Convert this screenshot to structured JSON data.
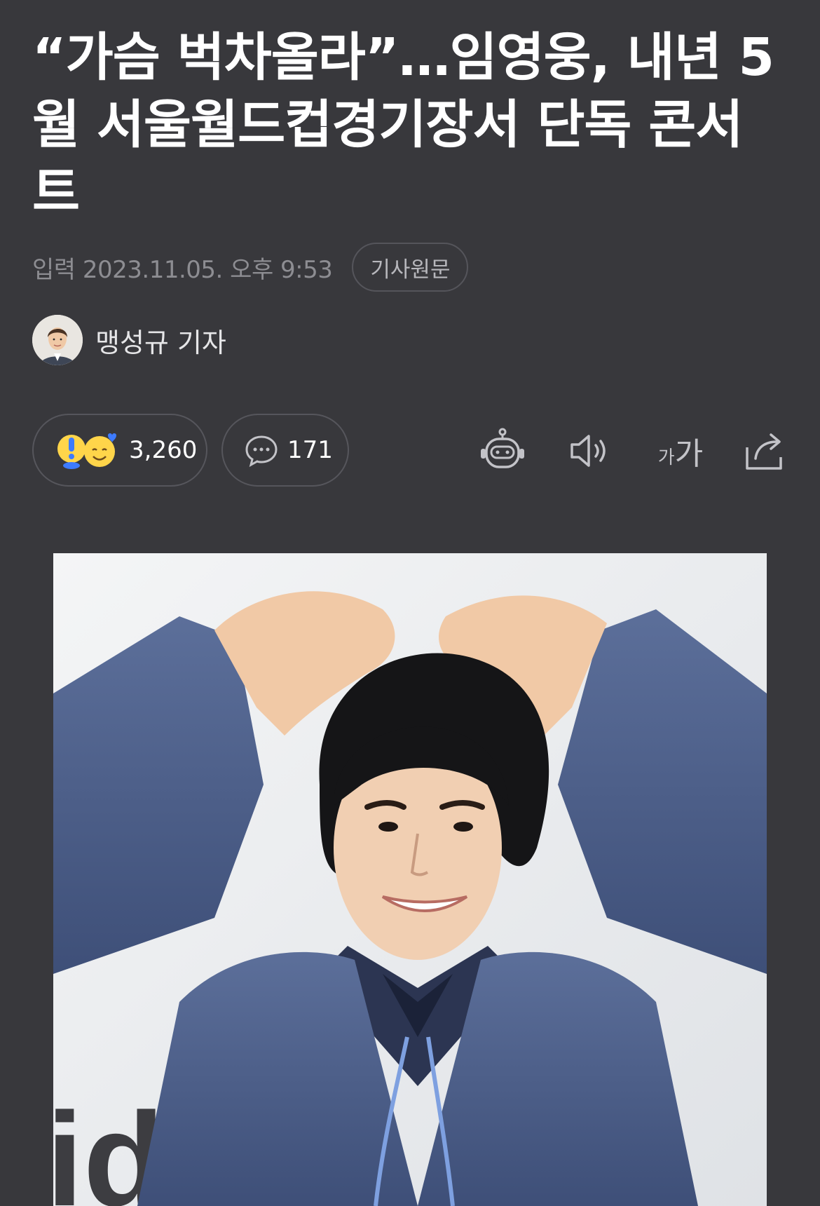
{
  "article": {
    "headline_lines": [
      "“가슴 벅차올라”…임영웅, 내년 5",
      "월 서울월드컵경기장서 단독 콘서",
      "트"
    ],
    "input_label": "입력",
    "date_value": "2023.11.05. 오후 9:53",
    "original_link_label": "기사원문",
    "author": "맹성규 기자"
  },
  "actions": {
    "reaction_count": "3,260",
    "comment_count": "171",
    "font_size_icon_text": "가가",
    "icons": [
      "surprised-emoji-icon",
      "smile-emoji-icon",
      "comment-bubble-icon",
      "robot-summary-icon",
      "speaker-icon",
      "font-size-icon",
      "share-icon"
    ]
  },
  "photo": {
    "description_icon": "article-photo"
  },
  "colors": {
    "background": "#38383c",
    "headline": "#ffffff",
    "meta": "#8d8d92",
    "border": "#56565c",
    "emoji_yellow": "#ffd54a",
    "emoji_blue": "#3d7bff"
  }
}
